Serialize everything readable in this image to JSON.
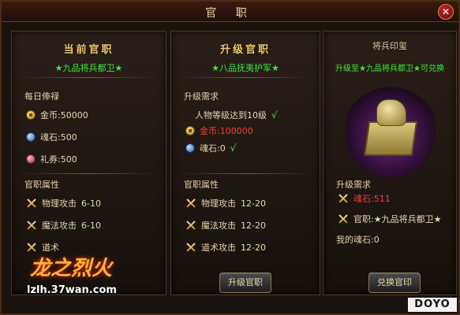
{
  "window": {
    "title": "官 职",
    "close_symbol": "✕"
  },
  "current": {
    "title": "当前官职",
    "rank": "★九品将兵都卫★",
    "daily_salary_label": "每日俸禄",
    "salary": [
      {
        "icon": "coin-icon",
        "label": "金币:",
        "value": "50000"
      },
      {
        "icon": "soul-stone-icon",
        "label": "魂石:",
        "value": "500"
      },
      {
        "icon": "gift-voucher-icon",
        "label": "礼券:",
        "value": "500"
      }
    ],
    "attributes_label": "官职属性",
    "attributes": [
      {
        "icon": "swords-icon",
        "label": "物理攻击",
        "value": "6-10"
      },
      {
        "icon": "swords-icon",
        "label": "魔法攻击",
        "value": "6-10"
      },
      {
        "icon": "swords-icon",
        "label": "道术",
        "value": ""
      }
    ]
  },
  "upgrade": {
    "title": "升级官职",
    "rank": "★八品抚夷护军★",
    "requirements_label": "升级需求",
    "requirements": [
      {
        "label": "人物等级达到10级",
        "status": "√"
      },
      {
        "icon": "coin-icon",
        "label": "金币:",
        "value": "100000",
        "status": ""
      },
      {
        "icon": "soul-stone-icon",
        "label": "魂石:",
        "value": "0",
        "status": "√"
      }
    ],
    "attributes_label": "官职属性",
    "attributes": [
      {
        "icon": "swords-icon",
        "label": "物理攻击",
        "value": "12-20"
      },
      {
        "icon": "swords-icon",
        "label": "魔法攻击",
        "value": "12-20"
      },
      {
        "icon": "swords-icon",
        "label": "道术攻击",
        "value": "12-20"
      }
    ],
    "button": "升级官职"
  },
  "seal": {
    "title": "将兵印玺",
    "subtitle": "升级至★九品将兵都卫★可兑换",
    "requirements_label": "升级需求",
    "requirements": [
      {
        "icon": "swords-icon",
        "label": "魂石:",
        "value": "511"
      },
      {
        "icon": "swords-icon",
        "label": "官职:",
        "value": "★九品将兵都卫★"
      }
    ],
    "my_stones_label": "我的魂石:",
    "my_stones_value": "0",
    "button": "兑换官印"
  },
  "logo": {
    "main": "龙之烈火",
    "url": "lzlh.37wan.com"
  },
  "watermark": "DOYO"
}
